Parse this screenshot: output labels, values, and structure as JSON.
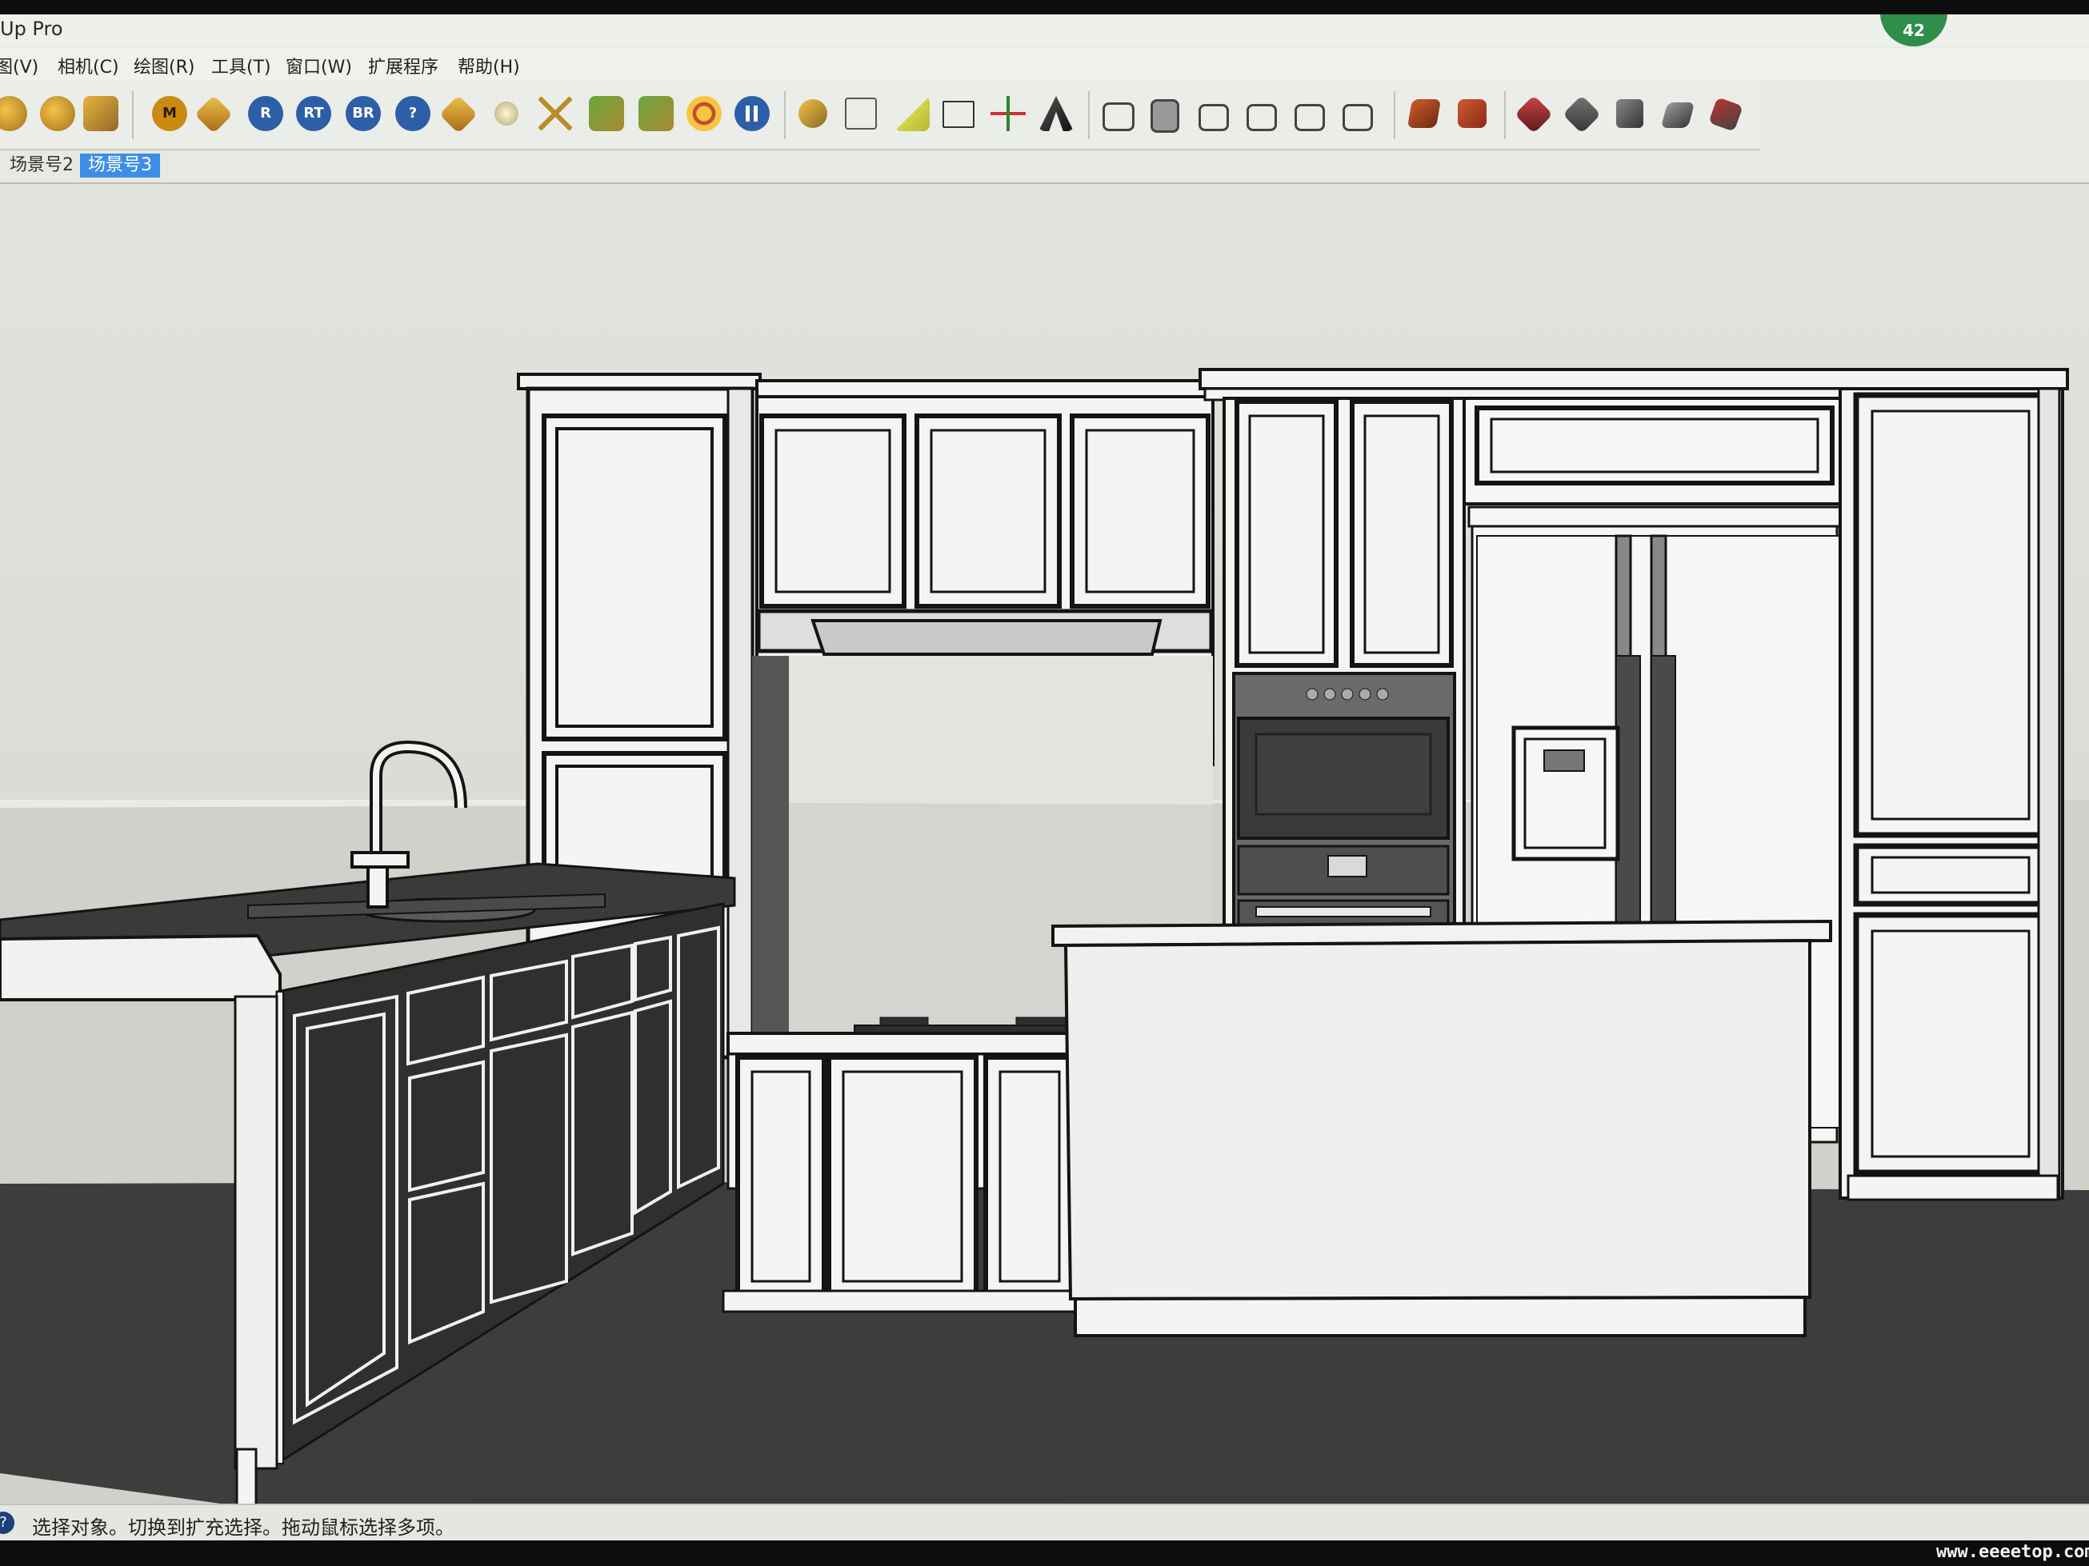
{
  "window": {
    "title": "Up Pro",
    "badge": "42"
  },
  "menu": [
    "图(V)",
    "相机(C)",
    "绘图(R)",
    "工具(T)",
    "窗口(W)",
    "扩展程序",
    "帮助(H)"
  ],
  "toolbar": {
    "letter_tools": [
      "M",
      "R",
      "RT",
      "BR",
      "?"
    ],
    "icons": [
      "sphere-icon",
      "sphere-icon",
      "paint-icon",
      "material-icon",
      "tag-icon",
      "render-icon",
      "render-icon",
      "help-icon",
      "tag-icon",
      "light-icon",
      "cross-icon",
      "plant-icon",
      "plant-icon",
      "target-icon",
      "pause-icon",
      "tape-measure-icon",
      "dimension-icon",
      "protractor-icon",
      "text-label-icon",
      "axes-icon",
      "3d-text-icon",
      "iso-view-icon",
      "top-view-icon",
      "front-view-icon",
      "right-view-icon",
      "back-view-icon",
      "left-view-icon",
      "section-icon",
      "section-icon",
      "sandbox-icon",
      "sandbox-icon",
      "sandbox-icon",
      "sandbox-icon",
      "sandbox-icon"
    ]
  },
  "scene_tabs": [
    "场景号2",
    "场景号3"
  ],
  "active_tab": "场景号3",
  "status": {
    "text": "选择对象。切换到扩充选择。拖动鼠标选择多项。"
  },
  "watermark": "www.eeeetop.com",
  "colors": {
    "accent_tab": "#3c8ee8",
    "badge": "#2f8f4a"
  }
}
